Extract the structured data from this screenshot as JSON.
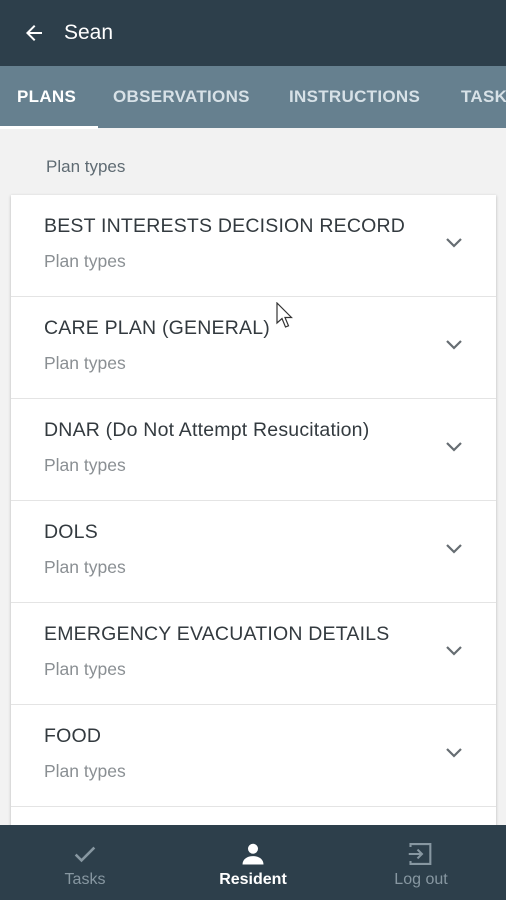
{
  "header": {
    "title": "Sean"
  },
  "tabs": [
    {
      "label": "PLANS",
      "active": true
    },
    {
      "label": "OBSERVATIONS",
      "active": false
    },
    {
      "label": "INSTRUCTIONS",
      "active": false
    },
    {
      "label": "TASKS",
      "active": false
    }
  ],
  "main": {
    "section_label": "Plan types",
    "plans": [
      {
        "title": "BEST INTERESTS DECISION RECORD",
        "subtitle": "Plan types"
      },
      {
        "title": "CARE PLAN (GENERAL)",
        "subtitle": "Plan types"
      },
      {
        "title": "DNAR (Do Not Attempt Resucitation)",
        "subtitle": "Plan types"
      },
      {
        "title": "DOLS",
        "subtitle": "Plan types"
      },
      {
        "title": "EMERGENCY EVACUATION DETAILS",
        "subtitle": "Plan types"
      },
      {
        "title": "FOOD",
        "subtitle": "Plan types"
      }
    ]
  },
  "bottom_nav": {
    "items": [
      {
        "label": "Tasks",
        "icon": "check-icon",
        "active": false
      },
      {
        "label": "Resident",
        "icon": "person-icon",
        "active": true
      },
      {
        "label": "Log out",
        "icon": "logout-icon",
        "active": false
      }
    ]
  },
  "colors": {
    "appbar": "#2d3f4b",
    "tabs_bg": "#66808f",
    "background": "#f2f2f2",
    "nav_inactive": "#8797a1"
  }
}
